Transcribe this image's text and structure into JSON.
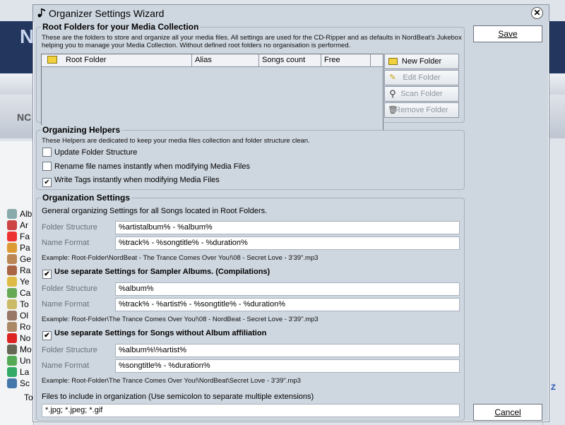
{
  "window": {
    "title": "Organizer Settings Wizard"
  },
  "background": {
    "logo": "N",
    "no_text": "NC",
    "side_items": [
      "Alb",
      "Ar",
      "Fa",
      "Pa",
      "Ge",
      "Ra",
      "Ye",
      "Ca",
      "To",
      "Ol",
      "Ro",
      "No",
      "Mo",
      "Un",
      "La",
      "Sc",
      "To"
    ],
    "z_label": "Z"
  },
  "root_folders": {
    "title": "Root Folders for your Media Collection",
    "desc_line1": "These are the folders to store and organize all your media files. All settings are used for the CD-Ripper and as defaults in NordBeat's Jukebox",
    "desc_line2": "helping you to manage your Media Collection. Without defined root folders no organisation is performed.",
    "columns": [
      "Root Folder",
      "Alias",
      "Songs count",
      "Free"
    ],
    "buttons": {
      "new": "New Folder",
      "edit": "Edit Folder",
      "scan": "Scan Folder",
      "remove": "Remove Folder"
    }
  },
  "helpers": {
    "title": "Organizing Helpers",
    "desc": "These Helpers are dedicated to keep your media files collection and folder structure clean.",
    "options": [
      {
        "label": "Update Folder Structure",
        "checked": false
      },
      {
        "label": "Rename file names instantly when modifying Media Files",
        "checked": false
      },
      {
        "label": "Write Tags instantly when modifying Media Files",
        "checked": true
      }
    ]
  },
  "org": {
    "title": "Organization Settings",
    "desc": "General organizing Settings for all Songs located in Root Folders.",
    "folder_label": "Folder Structure",
    "name_label": "Name Format",
    "general": {
      "folder": "%artistalbum% - %album%",
      "name": "%track% - %songtitle% - %duration%",
      "example": "Example: Root-Folder\\NordBeat - The Trance Comes Over You!\\08 - Secret Love - 3'39\".mp3"
    },
    "sampler": {
      "header": "Use separate Settings for Sampler Albums. (Compilations)",
      "checked": true,
      "folder": "%album%",
      "name": "%track% - %artist% - %songtitle% - %duration%",
      "example": "Example: Root-Folder\\The Trance Comes Over You!\\08 - NordBeat - Secret Love - 3'39\".mp3"
    },
    "noalbum": {
      "header": "Use separate Settings for Songs without Album affiliation",
      "checked": true,
      "folder": "%album%\\%artist%",
      "name": "%songtitle% - %duration%",
      "example": "Example: Root-Folder\\The Trance Comes Over You!\\NordBeat\\Secret Love - 3'39\".mp3"
    },
    "files_label": "Files to include in organization (Use semicolon to separate multiple extensions)",
    "files_value": "*.jpg; *.jpeg; *.gif"
  },
  "actions": {
    "save": "Save",
    "cancel": "Cancel"
  }
}
